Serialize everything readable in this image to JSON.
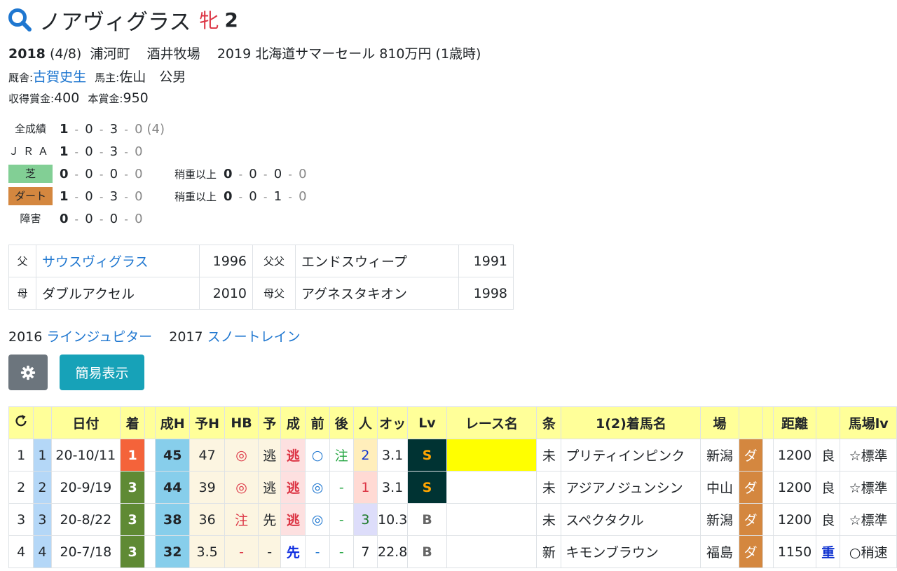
{
  "horse": {
    "name": "ノアヴィグラス",
    "sex": "牝",
    "age": "2"
  },
  "info": {
    "birth_year": "2018",
    "birth_date": "(4/8)",
    "region": "浦河町",
    "farm": "酒井牧場",
    "sale": "2019 北海道サマーセール 810万円 (1歳時)",
    "trainer_label": "厩舎:",
    "trainer": "古賀史生",
    "owner_label": "馬主:",
    "owner": "佐山　公男",
    "earned_label": "収得賞金:",
    "earned": "400",
    "prize_label": "本賞金:",
    "prize": "950"
  },
  "records": {
    "all": {
      "label": "全成績",
      "nums": [
        "1",
        "0",
        "3",
        "0"
      ],
      "extra": "(4)"
    },
    "jra": {
      "label": "ＪＲＡ",
      "nums": [
        "1",
        "0",
        "3",
        "0"
      ]
    },
    "turf": {
      "label": "芝",
      "nums": [
        "0",
        "0",
        "0",
        "0"
      ],
      "sub_label": "稍重以上",
      "sub": [
        "0",
        "0",
        "0",
        "0"
      ]
    },
    "dirt": {
      "label": "ダート",
      "nums": [
        "1",
        "0",
        "3",
        "0"
      ],
      "sub_label": "稍重以上",
      "sub": [
        "0",
        "0",
        "1",
        "0"
      ]
    },
    "obstacle": {
      "label": "障害",
      "nums": [
        "0",
        "0",
        "0",
        "0"
      ]
    }
  },
  "pedigree": {
    "sire_label": "父",
    "sire": "サウスヴィグラス",
    "sire_year": "1996",
    "sire_sire_label": "父父",
    "sire_sire": "エンドスウィープ",
    "sire_sire_year": "1991",
    "dam_label": "母",
    "dam": "ダブルアクセル",
    "dam_year": "2010",
    "dam_sire_label": "母父",
    "dam_sire": "アグネスタキオン",
    "dam_sire_year": "1998"
  },
  "progeny": [
    {
      "year": "2016",
      "name": "ラインジュピター"
    },
    {
      "year": "2017",
      "name": "スノートレイン"
    }
  ],
  "buttons": {
    "settings_icon": "gear-icon",
    "simple_label": "簡易表示"
  },
  "table": {
    "headers": [
      "日付",
      "着",
      "成H",
      "予H",
      "HB",
      "予",
      "成",
      "前",
      "後",
      "人",
      "オッ",
      "Lv",
      "レース名",
      "条",
      "1(2)着馬名",
      "場",
      "",
      "距離",
      "",
      "馬場lv"
    ],
    "reload_icon": "reload-icon",
    "rows": [
      {
        "no": "1",
        "no2": "1",
        "date": "20-10/11",
        "pos": "1",
        "seih": "45",
        "yoh": "47",
        "hb": "◎",
        "yo": "逃",
        "sei": "逃",
        "mae": "○",
        "ato": "注",
        "ninki": "2",
        "odds": "3.1",
        "lv": "S",
        "race": "",
        "cond": "未",
        "winner": "プリティインピンク",
        "place": "新潟",
        "track": "ダ",
        "dist": "1200",
        "going": "良",
        "baba": "☆標準"
      },
      {
        "no": "2",
        "no2": "2",
        "date": "20-9/19",
        "pos": "3",
        "seih": "44",
        "yoh": "39",
        "hb": "◎",
        "yo": "逃",
        "sei": "逃",
        "mae": "◎",
        "ato": "-",
        "ninki": "1",
        "odds": "3.1",
        "lv": "S",
        "race": "",
        "cond": "未",
        "winner": "アジアノジュンシン",
        "place": "中山",
        "track": "ダ",
        "dist": "1200",
        "going": "良",
        "baba": "☆標準"
      },
      {
        "no": "3",
        "no2": "3",
        "date": "20-8/22",
        "pos": "3",
        "seih": "38",
        "yoh": "36",
        "hb": "注",
        "yo": "先",
        "sei": "逃",
        "mae": "◎",
        "ato": "-",
        "ninki": "3",
        "odds": "10.3",
        "lv": "B",
        "race": "",
        "cond": "未",
        "winner": "スペクタクル",
        "place": "新潟",
        "track": "ダ",
        "dist": "1200",
        "going": "良",
        "baba": "☆標準"
      },
      {
        "no": "4",
        "no2": "4",
        "date": "20-7/18",
        "pos": "3",
        "seih": "32",
        "yoh": "3.5",
        "hb": "-",
        "yo": "-",
        "sei": "先",
        "mae": "-",
        "ato": "-",
        "ninki": "7",
        "odds": "22.8",
        "lv": "B",
        "race": "",
        "cond": "新",
        "winner": "キモンブラウン",
        "place": "福島",
        "track": "ダ",
        "dist": "1150",
        "going": "重",
        "baba": "○稍速"
      }
    ]
  }
}
